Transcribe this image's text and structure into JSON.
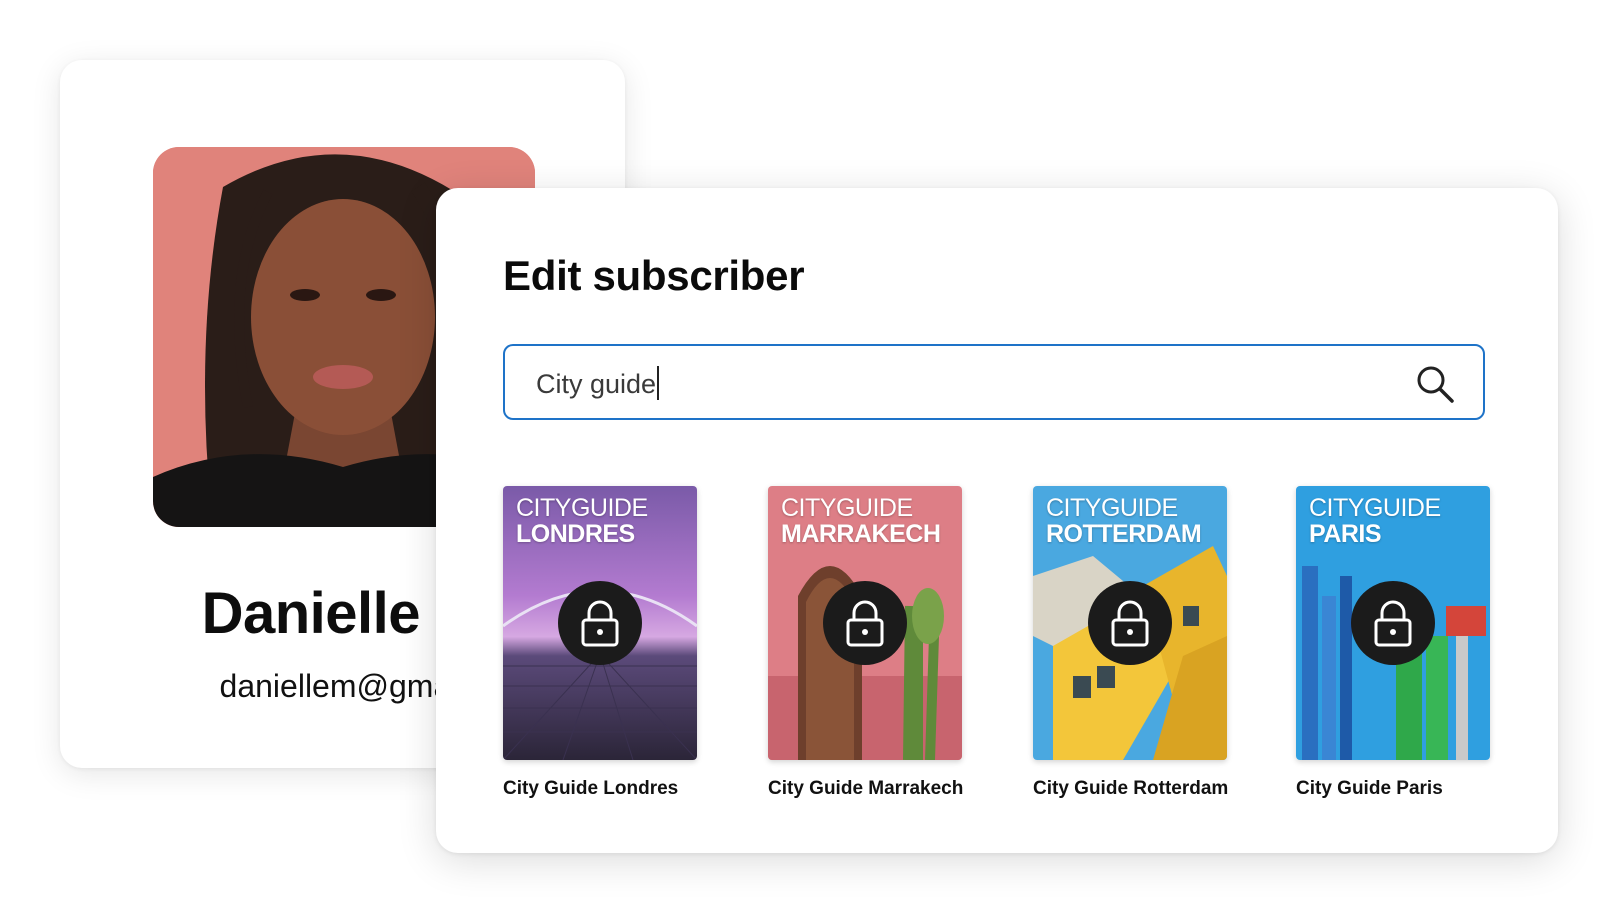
{
  "profile": {
    "name": "Danielle M",
    "email": "daniellem@gmail"
  },
  "modal": {
    "title": "Edit subscriber",
    "search": {
      "value": "City guide"
    },
    "guides": [
      {
        "brand": "CITYGUIDE",
        "city": "LONDRES",
        "label": "City Guide Londres",
        "locked": true
      },
      {
        "brand": "CITYGUIDE",
        "city": "MARRAKECH",
        "label": "City Guide Marrakech",
        "locked": true
      },
      {
        "brand": "CITYGUIDE",
        "city": "ROTTERDAM",
        "label": "City Guide Rotterdam",
        "locked": true
      },
      {
        "brand": "CITYGUIDE",
        "city": "PARIS",
        "label": "City Guide Paris",
        "locked": true
      }
    ]
  },
  "colors": {
    "accent": "#1e73c8",
    "avatar_bg": "#e0837b",
    "lock_bg": "#1b1b1b"
  },
  "icons": {
    "search": "search-icon",
    "lock": "lock-icon"
  }
}
